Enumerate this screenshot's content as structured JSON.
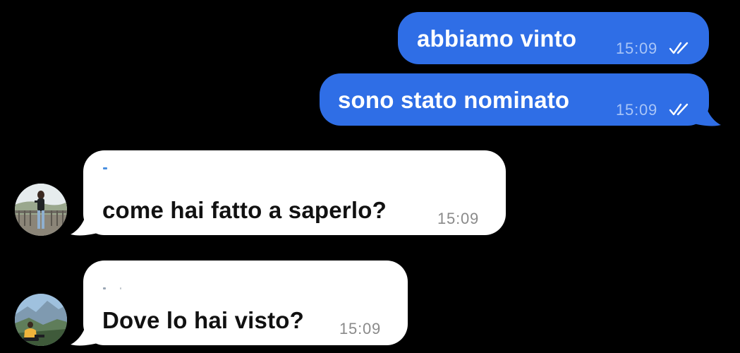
{
  "conversation": {
    "messages": [
      {
        "direction": "outgoing",
        "text": "abbiamo vinto",
        "time": "15:09",
        "status": "read-double-check"
      },
      {
        "direction": "outgoing",
        "text": "sono stato nominato",
        "time": "15:09",
        "status": "read-double-check"
      },
      {
        "direction": "incoming",
        "text": "come hai fatto a saperlo?",
        "time": "15:09",
        "avatar": "avatar-photo-girl-balcony"
      },
      {
        "direction": "incoming",
        "text": "Dove lo hai visto?",
        "time": "15:09",
        "avatar": "avatar-photo-hiker-mountain"
      }
    ]
  },
  "colors": {
    "background": "#000000",
    "outgoing_bubble": "#2f6ee6",
    "incoming_bubble": "#ffffff"
  }
}
